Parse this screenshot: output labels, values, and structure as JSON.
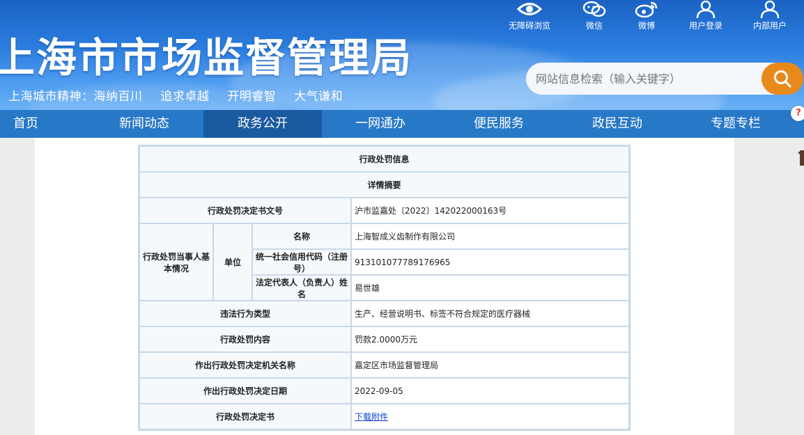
{
  "header": {
    "site_title": "上海市市场监督管理局",
    "slogan": [
      "上海城市精神：海纳百川",
      "追求卓越",
      "开明睿智",
      "大气谦和"
    ],
    "tools": [
      {
        "label": "无障碍浏览",
        "icon": "eye-icon"
      },
      {
        "label": "微信",
        "icon": "wechat-icon"
      },
      {
        "label": "微博",
        "icon": "weibo-icon"
      },
      {
        "label": "用户登录",
        "icon": "user-icon"
      },
      {
        "label": "内部用户",
        "icon": "user-icon"
      }
    ],
    "search": {
      "placeholder": "网站信息检索（输入关键字）",
      "icon": "search-icon"
    }
  },
  "nav": {
    "items": [
      "首页",
      "新闻动态",
      "政务公开",
      "一网通办",
      "便民服务",
      "政民互动",
      "专题专栏"
    ],
    "active": "政务公开"
  },
  "help_badge": "?",
  "colors": {
    "nav_bg": "#2878c8",
    "nav_active": "#1a5aa0",
    "search_button": "#e8891c",
    "table_border": "#c8d8e8",
    "link": "#0b3fd6"
  },
  "table": {
    "title": "行政处罚信息",
    "subtitle": "详情摘要",
    "decision_no_label": "行政处罚决定书文号",
    "decision_no": "沪市监嘉处〔2022〕142022000163号",
    "party_label": "行政处罚当事人基本情况",
    "unit_label": "单位",
    "name_label": "名称",
    "name": "上海智成义齿制作有限公司",
    "credit_code_label": "统一社会信用代码（注册号）",
    "credit_code": "913101077789176965",
    "legal_rep_label": "法定代表人（负责人）姓名",
    "legal_rep": "易世雄",
    "violation_type_label": "违法行为类型",
    "violation_type": "生产、经营说明书、标签不符合规定的医疗器械",
    "penalty_content_label": "行政处罚内容",
    "penalty_content": "罚款2.0000万元",
    "authority_label": "作出行政处罚决定机关名称",
    "authority": "嘉定区市场监督管理局",
    "date_label": "作出行政处罚决定日期",
    "date": "2022-09-05",
    "document_label": "行政处罚决定书",
    "download_link": "下载附件"
  }
}
